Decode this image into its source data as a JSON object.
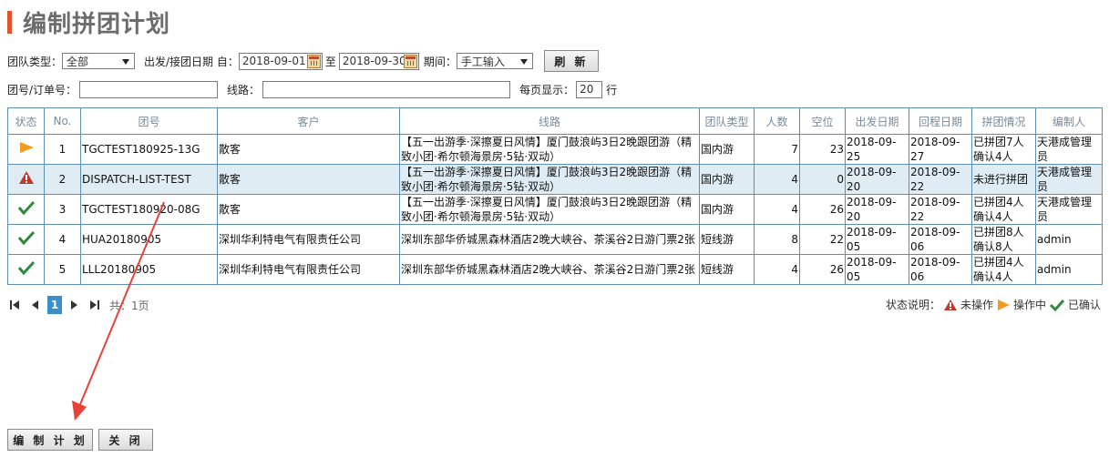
{
  "page": {
    "title": "编制拼团计划"
  },
  "filters": {
    "group_type_label": "团队类型：",
    "group_type_value": "全部",
    "date_label": "出发/接团日期 自：",
    "date_from": "2018-09-01",
    "date_to_label": "至",
    "date_to": "2018-09-30",
    "period_label": "期间：",
    "period_value": "手工输入",
    "refresh_label": "刷 新",
    "order_label": "团号/订单号：",
    "order_value": "",
    "route_label": "线路：",
    "route_value": "",
    "page_size_label": "每页显示：",
    "page_size_value": "20",
    "page_size_unit": "行"
  },
  "table": {
    "headers": [
      "状态",
      "No.",
      "团号",
      "客户",
      "线路",
      "团队类型",
      "人数",
      "空位",
      "出发日期",
      "回程日期",
      "拼团情况",
      "编制人"
    ],
    "rows": [
      {
        "status": "in-progress",
        "no": "1",
        "group_no": "TGCTEST180925-13G",
        "customer": "散客",
        "route": "【五一出游季·深擦夏日风情】厦门鼓浪屿3日2晚跟团游（精致小团·希尔顿海景房·5钻·双动）",
        "type": "国内游",
        "people": "7",
        "vacancy": "23",
        "depart": "2018-09-25",
        "return": "2018-09-27",
        "merge": "已拼团7人确认4人",
        "author": "天港成管理员"
      },
      {
        "status": "not-operated",
        "no": "2",
        "group_no": "DISPATCH-LIST-TEST",
        "customer": "散客",
        "route": "【五一出游季·深擦夏日风情】厦门鼓浪屿3日2晚跟团游（精致小团·希尔顿海景房·5钻·双动）",
        "type": "国内游",
        "people": "4",
        "vacancy": "0",
        "depart": "2018-09-20",
        "return": "2018-09-22",
        "merge": "未进行拼团",
        "author": "天港成管理员"
      },
      {
        "status": "confirmed",
        "no": "3",
        "group_no": "TGCTEST180920-08G",
        "customer": "散客",
        "route": "【五一出游季·深擦夏日风情】厦门鼓浪屿3日2晚跟团游（精致小团·希尔顿海景房·5钻·双动）",
        "type": "国内游",
        "people": "4",
        "vacancy": "26",
        "depart": "2018-09-20",
        "return": "2018-09-22",
        "merge": "已拼团4人确认4人",
        "author": "天港成管理员"
      },
      {
        "status": "confirmed",
        "no": "4",
        "group_no": "HUA20180905",
        "customer": "深圳华利特电气有限责任公司",
        "route": "深圳东部华侨城黑森林酒店2晚大峡谷、茶溪谷2日游门票2张",
        "type": "短线游",
        "people": "8",
        "vacancy": "22",
        "depart": "2018-09-05",
        "return": "2018-09-06",
        "merge": "已拼团8人确认8人",
        "author": "admin"
      },
      {
        "status": "confirmed",
        "no": "5",
        "group_no": "LLL20180905",
        "customer": "深圳华利特电气有限责任公司",
        "route": "深圳东部华侨城黑森林酒店2晚大峡谷、茶溪谷2日游门票2张",
        "type": "短线游",
        "people": "4",
        "vacancy": "26",
        "depart": "2018-09-05",
        "return": "2018-09-06",
        "merge": "已拼团4人确认4人",
        "author": "admin"
      }
    ]
  },
  "pager": {
    "current": "1",
    "total": "共：1页"
  },
  "legend": {
    "label": "状态说明：",
    "not_operated": "未操作",
    "in_progress": "操作中",
    "confirmed": "已确认"
  },
  "colors": {
    "in_progress": "#f59a23",
    "not_operated": "#c0392b",
    "confirmed": "#2e8b3a",
    "annotation": "#e8413a"
  },
  "actions": {
    "compile": "编 制 计 划",
    "close": "关 闭"
  }
}
